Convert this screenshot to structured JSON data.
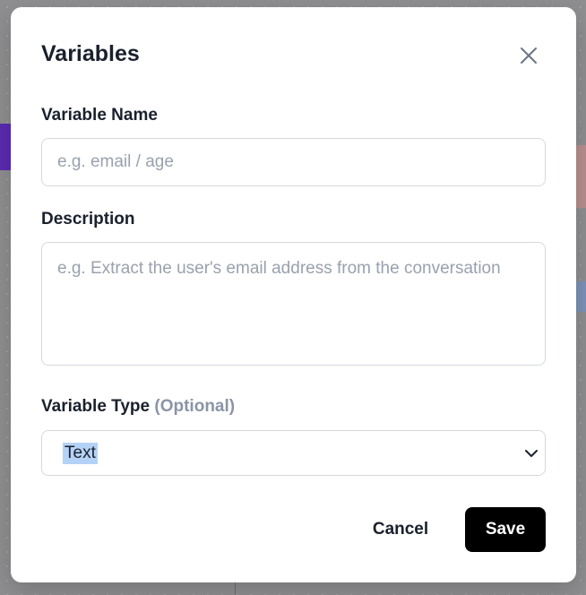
{
  "modal": {
    "title": "Variables",
    "close_icon": "close-icon"
  },
  "fields": {
    "variable_name": {
      "label": "Variable Name",
      "value": "",
      "placeholder": "e.g. email / age"
    },
    "description": {
      "label": "Description",
      "value": "",
      "placeholder": "e.g. Extract the user's email address from the conversation"
    },
    "variable_type": {
      "label": "Variable Type",
      "optional_label": "(Optional)",
      "selected": "Text",
      "chevron_icon": "chevron-down-icon"
    }
  },
  "actions": {
    "cancel_label": "Cancel",
    "save_label": "Save"
  },
  "colors": {
    "primary_button": "#000000",
    "text": "#1a202c",
    "muted": "#8a94a6",
    "border": "#d6d9e0",
    "selection": "#b4d2f5"
  }
}
